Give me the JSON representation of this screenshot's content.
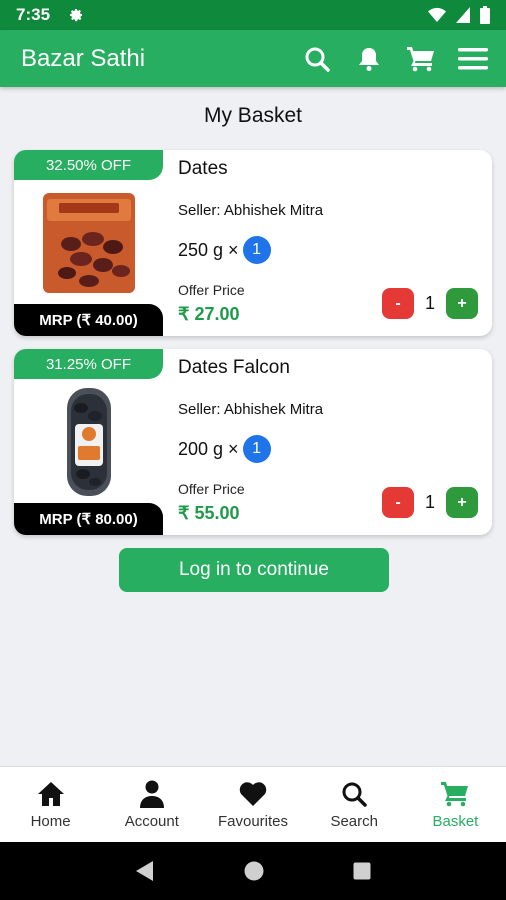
{
  "status_bar": {
    "time": "7:35"
  },
  "app_bar": {
    "title": "Bazar Sathi"
  },
  "page_title": "My Basket",
  "items": [
    {
      "discount": "32.50% OFF",
      "mrp": "MRP (₹ 40.00)",
      "name": "Dates",
      "seller": "Seller: Abhishek Mitra",
      "weight": "250 g ×",
      "pack_count": "1",
      "offer_label": "Offer Price",
      "offer_price": "₹ 27.00",
      "minus": "-",
      "quantity": "1",
      "plus": "+"
    },
    {
      "discount": "31.25% OFF",
      "mrp": "MRP (₹ 80.00)",
      "name": "Dates Falcon",
      "seller": "Seller: Abhishek Mitra",
      "weight": "200 g ×",
      "pack_count": "1",
      "offer_label": "Offer Price",
      "offer_price": "₹ 55.00",
      "minus": "-",
      "quantity": "1",
      "plus": "+"
    }
  ],
  "login_button": "Log in to continue",
  "bottom_nav": [
    {
      "label": "Home",
      "icon": "home-icon"
    },
    {
      "label": "Account",
      "icon": "account-icon"
    },
    {
      "label": "Favourites",
      "icon": "heart-icon"
    },
    {
      "label": "Search",
      "icon": "search-icon"
    },
    {
      "label": "Basket",
      "icon": "cart-icon",
      "active": true
    }
  ],
  "colors": {
    "primary": "#27ae60",
    "status_bar": "#0f8a3c",
    "price_green": "#1f9a4a",
    "minus_red": "#e53935",
    "badge_blue": "#1e74e8"
  }
}
